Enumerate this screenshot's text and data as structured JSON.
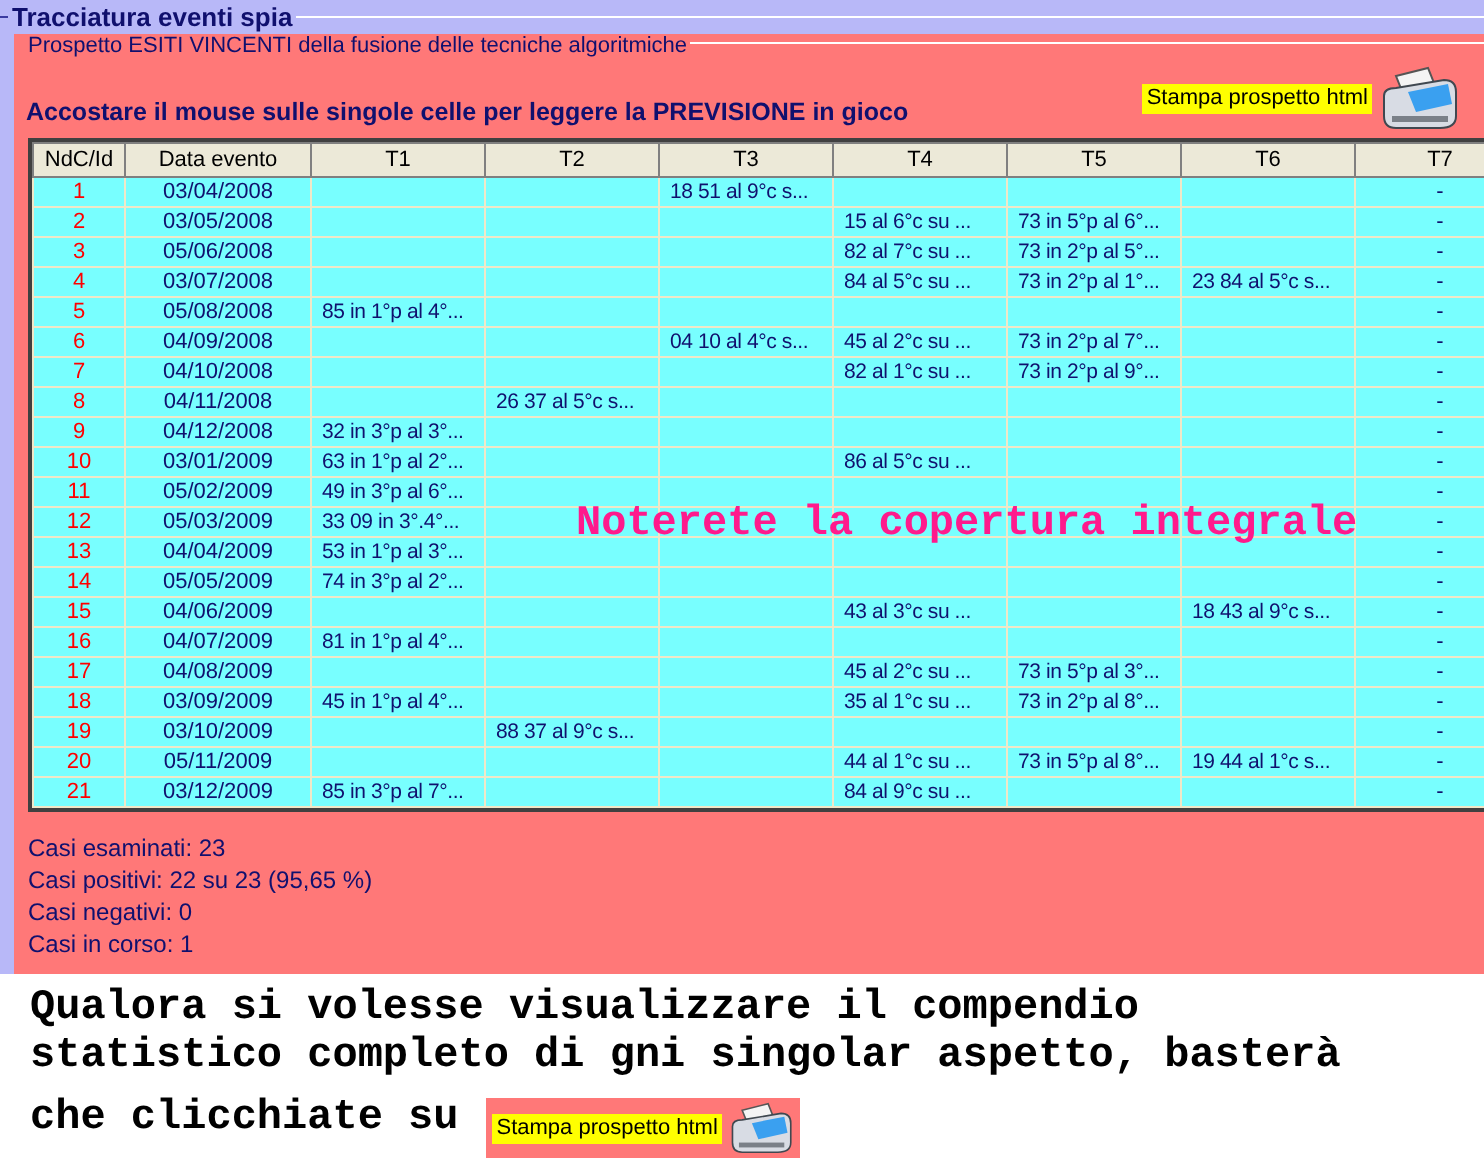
{
  "window": {
    "title": "Tracciatura eventi spia"
  },
  "panel": {
    "legend": "Prospetto ESITI VINCENTI della fusione delle tecniche algoritmiche",
    "instruction": "Accostare il mouse sulle singole celle per leggere la PREVISIONE in gioco",
    "print_button": "Stampa prospetto html"
  },
  "table": {
    "columns": [
      "NdC/Id",
      "Data evento",
      "T1",
      "T2",
      "T3",
      "T4",
      "T5",
      "T6",
      "T7"
    ],
    "rows": [
      {
        "number": "1",
        "date": "03/04/2008",
        "t3": "18 51 al 9°c s...",
        "t7": "-"
      },
      {
        "number": "2",
        "date": "03/05/2008",
        "t4": "15 al 6°c su ...",
        "t5": "73 in 5°p al 6°...",
        "t7": "-"
      },
      {
        "number": "3",
        "date": "05/06/2008",
        "t4": "82 al 7°c su ...",
        "t5": "73 in 2°p al 5°...",
        "t7": "-"
      },
      {
        "number": "4",
        "date": "03/07/2008",
        "t4": "84 al 5°c su ...",
        "t5": "73 in 2°p al 1°...",
        "t6": "23 84 al 5°c s...",
        "t7": "-"
      },
      {
        "number": "5",
        "date": "05/08/2008",
        "t1": "85 in 1°p al 4°...",
        "t7": "-"
      },
      {
        "number": "6",
        "date": "04/09/2008",
        "t3": "04 10 al 4°c s...",
        "t4": "45 al 2°c su ...",
        "t5": "73 in 2°p al 7°...",
        "t7": "-"
      },
      {
        "number": "7",
        "date": "04/10/2008",
        "t4": "82 al 1°c su ...",
        "t5": "73 in 2°p al 9°...",
        "t7": "-"
      },
      {
        "number": "8",
        "date": "04/11/2008",
        "t2": "26 37 al 5°c s...",
        "t7": "-"
      },
      {
        "number": "9",
        "date": "04/12/2008",
        "t1": "32 in 3°p al 3°...",
        "t7": "-"
      },
      {
        "number": "10",
        "date": "03/01/2009",
        "t1": "63 in 1°p al 2°...",
        "t4": "86 al 5°c su ...",
        "t7": "-"
      },
      {
        "number": "11",
        "date": "05/02/2009",
        "t1": "49 in 3°p al 6°...",
        "t7": "-"
      },
      {
        "number": "12",
        "date": "05/03/2009",
        "t1": "33 09 in 3°.4°...",
        "t7": "-"
      },
      {
        "number": "13",
        "date": "04/04/2009",
        "t1": "53 in 1°p al 3°...",
        "t7": "-"
      },
      {
        "number": "14",
        "date": "05/05/2009",
        "t1": "74 in 3°p al 2°...",
        "t7": "-"
      },
      {
        "number": "15",
        "date": "04/06/2009",
        "t4": "43 al 3°c su ...",
        "t6": "18 43 al 9°c s...",
        "t7": "-"
      },
      {
        "number": "16",
        "date": "04/07/2009",
        "t1": "81 in 1°p al 4°...",
        "t7": "-"
      },
      {
        "number": "17",
        "date": "04/08/2009",
        "t4": "45 al 2°c su ...",
        "t5": "73 in 5°p al 3°...",
        "t7": "-"
      },
      {
        "number": "18",
        "date": "03/09/2009",
        "t1": "45 in 1°p al 4°...",
        "t4": "35 al 1°c su ...",
        "t5": "73 in 2°p al 8°...",
        "t7": "-"
      },
      {
        "number": "19",
        "date": "03/10/2009",
        "t2": "88 37 al 9°c s...",
        "t7": "-"
      },
      {
        "number": "20",
        "date": "05/11/2009",
        "t4": "44 al 1°c su ...",
        "t5": "73 in 5°p al 8°...",
        "t6": "19 44 al 1°c s...",
        "t7": "-"
      },
      {
        "number": "21",
        "date": "03/12/2009",
        "t1": "85 in 3°p al 7°...",
        "t4": "84 al 9°c su ...",
        "t7": "-"
      }
    ],
    "overlay_note": "Noterete la copertura integrale"
  },
  "stats": [
    "Casi esaminati: 23",
    "Casi positivi: 22 su 23 (95,65 %)",
    "Casi negativi: 0",
    "Casi in corso: 1"
  ],
  "footer": {
    "lines": [
      "Qualora si volesse visualizzare il compendio",
      "statistico completo di gni singolar aspetto, basterà",
      "che clicchiate su"
    ],
    "print_button": "Stampa prospetto html"
  }
}
